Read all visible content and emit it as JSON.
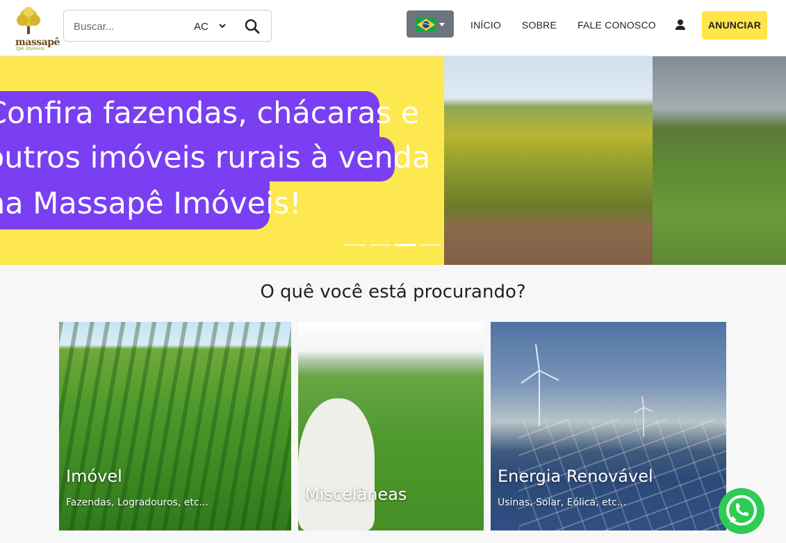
{
  "header": {
    "logo": {
      "brand": "massapê",
      "subtitle": "Ipê Imóveis"
    },
    "search": {
      "placeholder": "Buscar...",
      "state_value": "AC"
    },
    "language": {
      "flag": "brazil-flag"
    },
    "nav": [
      {
        "label": "INÍCIO"
      },
      {
        "label": "SOBRE"
      },
      {
        "label": "FALE CONOSCO"
      }
    ],
    "cta_label": "ANUNCIAR"
  },
  "hero": {
    "lines": [
      "Confira fazendas, chácaras e",
      "outros imóveis rurais à venda",
      "na Massapê Imóveis!"
    ],
    "indicator_count": 4,
    "active_indicator": 2
  },
  "section": {
    "title": "O quê você está procurando?",
    "cards": [
      {
        "title": "Imóvel",
        "subtitle": "Fazendas, Logradouros, etc..."
      },
      {
        "title": "Miscelâneas",
        "subtitle": ""
      },
      {
        "title": "Energia Renovável",
        "subtitle": "Usinas, Solar, Eólica, etc..."
      }
    ]
  },
  "colors": {
    "accent_yellow": "#ffe44a",
    "hero_purple": "#7a3ff2",
    "whatsapp_green": "#2ecb55"
  }
}
